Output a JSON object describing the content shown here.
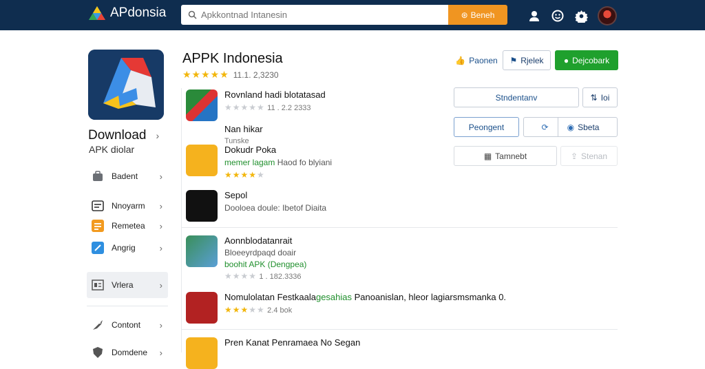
{
  "header": {
    "brand": "APdonsia",
    "search_placeholder": "Apkkontnad Intanesin",
    "search_button": "Beneh"
  },
  "sidebar": {
    "download_title": "Download",
    "download_sub": "APK diolar",
    "items": [
      {
        "label": "Badent",
        "icon": "bag-icon"
      },
      {
        "label": "Nnoyarm",
        "icon": "list-icon"
      },
      {
        "label": "Remetea",
        "icon": "menu-icon"
      },
      {
        "label": "Angrig",
        "icon": "wrench-icon"
      },
      {
        "label": "Vrlera",
        "icon": "grid-icon"
      },
      {
        "label": "Contont",
        "icon": "tag-icon"
      },
      {
        "label": "Domdene",
        "icon": "shield-icon"
      }
    ]
  },
  "main": {
    "title": "APPK Indonesia",
    "rating_text": "11.1. 2,3230",
    "rating_value": 4.5,
    "actions": {
      "paonen": "Paonen",
      "rjelek": "Rjelek",
      "dejcobark": "Dejcobark",
      "stndentanv": "Stndentanv",
      "tloi": "Ioi",
      "peongent": "Peongent",
      "sbeta": "Sbeta",
      "tamnebt": "Tamnebt",
      "stenan": "Stenan"
    },
    "list": [
      {
        "title": "Rovnland hadi blotatasad",
        "sub": "",
        "meta": "11 . 2.2 2333",
        "rating": 2.5
      },
      {
        "title": "Nan hikar",
        "sub": "Tunske",
        "meta": "",
        "rating": 0
      },
      {
        "title": "Dokudr Poka",
        "sub_green": "memer lagam",
        "sub": "Haod fo blyiani",
        "meta": "",
        "rating": 4
      },
      {
        "title": "Sepol",
        "sub": "Dooloea doule: Ibetof Diaita",
        "meta": "",
        "rating": 0
      },
      {
        "title": "Aonnblodatanrait",
        "sub": "Bloeeyrdpaqd doair",
        "sub_green": "boohit APK (Dengpea)",
        "meta": "1 . 182.3336",
        "rating": 3.5
      },
      {
        "title": "Nomulolatan Festkaala",
        "title_green": "gesahias",
        "title_rest": "Panoanislan, hleor lagiarsmsmanka 0.",
        "meta": "2.4 bok",
        "rating": 3
      },
      {
        "title": "Pren Kanat Penramaea No Segan",
        "meta": "",
        "rating": 0
      }
    ]
  }
}
